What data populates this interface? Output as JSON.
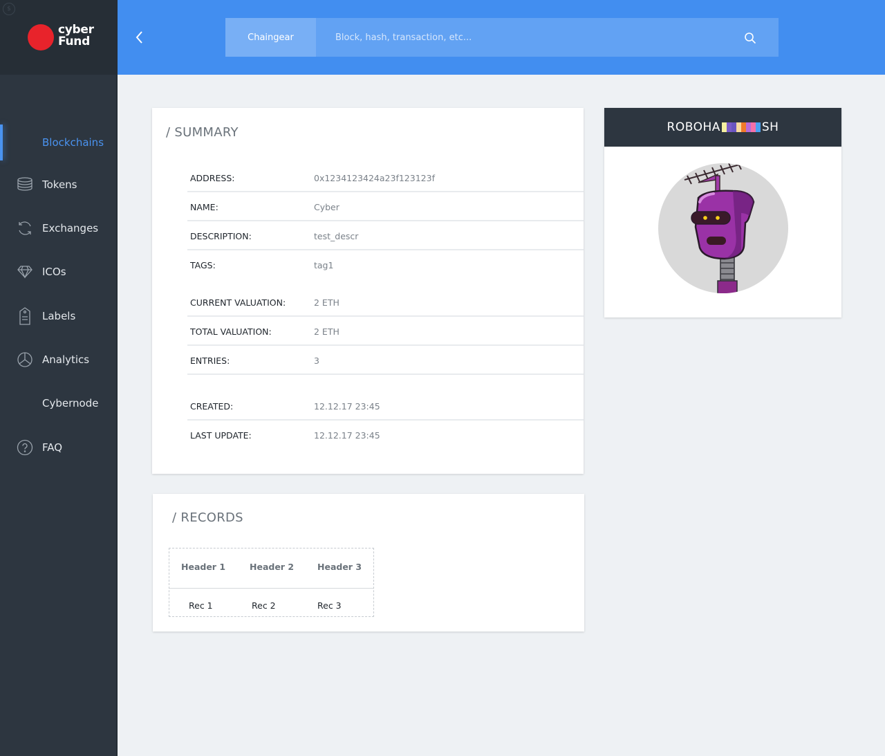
{
  "brand": {
    "line1": "cyber",
    "line2": "Fund",
    "accent": "#e8232b"
  },
  "sidebar": {
    "items": [
      {
        "label": "Blockchains",
        "icon": "blockchain-icon",
        "active": true
      },
      {
        "label": "Tokens",
        "icon": "coins-stack-icon"
      },
      {
        "label": "Exchanges",
        "icon": "refresh-icon"
      },
      {
        "label": "ICOs",
        "icon": "diamond-icon"
      },
      {
        "label": "Labels",
        "icon": "tag-icon"
      },
      {
        "label": "Analytics",
        "icon": "pie-chart-icon"
      },
      {
        "label": "Cybernode",
        "icon": ""
      },
      {
        "label": "FAQ",
        "icon": "question-icon"
      }
    ]
  },
  "header": {
    "search_tab": "Chaingear",
    "search_placeholder": "Block, hash, transaction, etc..."
  },
  "summary": {
    "title": "/ SUMMARY",
    "rows": [
      {
        "key": "ADDRESS:",
        "value": "0x1234123424a23f123123f"
      },
      {
        "key": "NAME:",
        "value": "Cyber"
      },
      {
        "key": "DESCRIPTION:",
        "value": "test_descr"
      },
      {
        "key": "TAGS:",
        "value": "tag1"
      },
      {
        "key": "CURRENT VALUATION:",
        "value": "2 ETH"
      },
      {
        "key": "TOTAL VALUATION:",
        "value": "2 ETH"
      },
      {
        "key": "ENTRIES:",
        "value": "3"
      },
      {
        "key": "CREATED:",
        "value": "12.12.17 23:45"
      },
      {
        "key": "LAST UPDATE:",
        "value": "12.12.17 23:45"
      }
    ]
  },
  "records": {
    "title": "/ RECORDS",
    "headers": [
      "Header 1",
      "Header 2",
      "Header 3"
    ],
    "rows": [
      [
        "Rec 1",
        "Rec 2",
        "Rec 3"
      ]
    ]
  },
  "robohash": {
    "title_start": "ROBOHA",
    "title_end": "SH",
    "bar_colors": [
      "#f5f0a0",
      "#7b5cc9",
      "#6a55c0",
      "#f7b06a",
      "#f07a2a",
      "#b86ad8",
      "#f470a8",
      "#4aa0f0"
    ]
  },
  "colors": {
    "primary": "#428ef0",
    "sidebar": "#2d3640",
    "active": "#4a93f0"
  }
}
